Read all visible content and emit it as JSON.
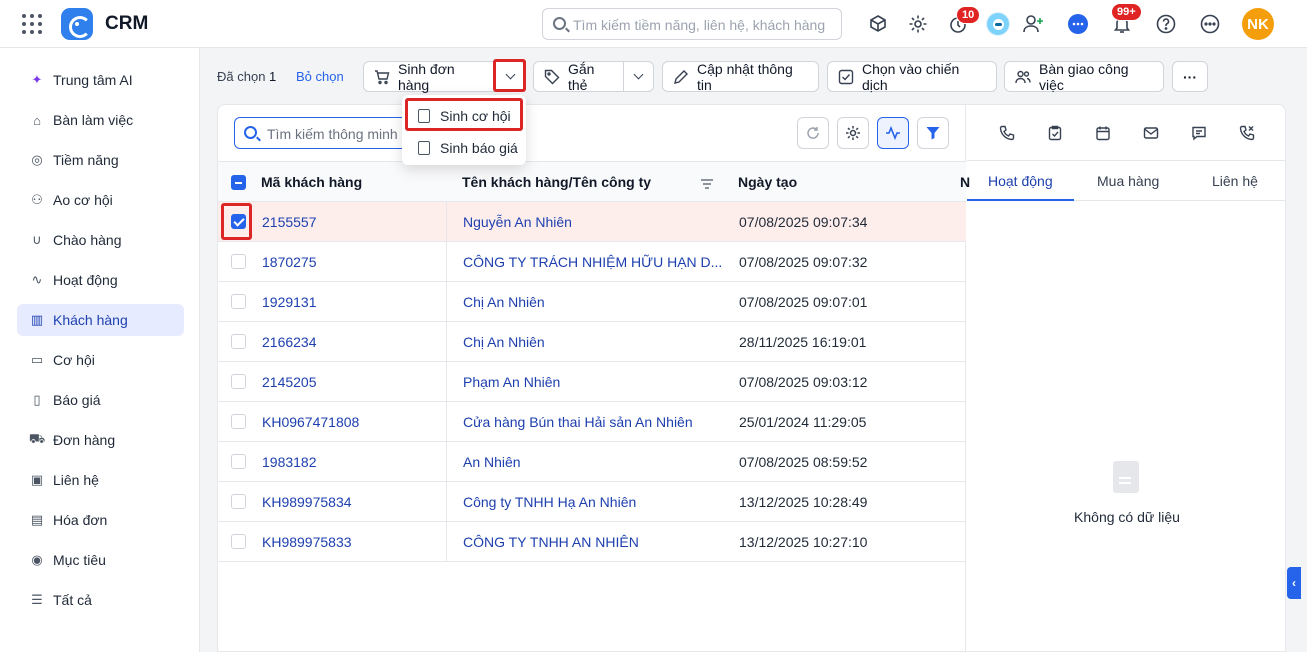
{
  "app": {
    "title": "CRM"
  },
  "topbar": {
    "search_placeholder": "Tìm kiếm tiềm năng, liên hệ, khách hàng",
    "timer_badge": "10",
    "notification_badge": "99+",
    "avatar_initials": "NK",
    "avatar_color": "#f59e0b"
  },
  "sidebar": {
    "items": [
      {
        "label": "Trung tâm AI",
        "icon": "sparkle-icon"
      },
      {
        "label": "Bàn làm việc",
        "icon": "home-icon"
      },
      {
        "label": "Tiềm năng",
        "icon": "target-icon"
      },
      {
        "label": "Ao cơ hội",
        "icon": "pool-icon"
      },
      {
        "label": "Chào hàng",
        "icon": "magnet-icon"
      },
      {
        "label": "Hoạt động",
        "icon": "pulse-icon"
      },
      {
        "label": "Khách hàng",
        "icon": "building-icon",
        "active": true
      },
      {
        "label": "Cơ hội",
        "icon": "wallet-icon"
      },
      {
        "label": "Báo giá",
        "icon": "quote-icon"
      },
      {
        "label": "Đơn hàng",
        "icon": "cart-icon"
      },
      {
        "label": "Liên hệ",
        "icon": "contact-icon"
      },
      {
        "label": "Hóa đơn",
        "icon": "invoice-icon"
      },
      {
        "label": "Mục tiêu",
        "icon": "goal-icon"
      },
      {
        "label": "Tất cả",
        "icon": "list-icon"
      }
    ]
  },
  "actionbar": {
    "selected_label": "Đã chọn",
    "selected_count": "1",
    "deselect": "Bỏ chọn",
    "create_order": "Sinh đơn hàng",
    "tag": "Gắn thẻ",
    "update_info": "Cập nhật thông tin",
    "add_campaign": "Chọn vào chiến dịch",
    "handover": "Bàn giao công việc",
    "more": "···"
  },
  "dropdown": {
    "items": [
      "Sinh cơ hội",
      "Sinh báo giá"
    ]
  },
  "list": {
    "search_placeholder": "Tìm kiếm thông minh",
    "columns": [
      "Mã khách hàng",
      "Tên khách hàng/Tên công ty",
      "Ngày tạo",
      "N"
    ],
    "rows": [
      {
        "code": "2155557",
        "name": "Nguyễn An Nhiên",
        "created": "07/08/2025 09:07:34",
        "checked": true
      },
      {
        "code": "1870275",
        "name": "CÔNG TY TRÁCH NHIỆM HỮU HẠN D...",
        "created": "07/08/2025 09:07:32"
      },
      {
        "code": "1929131",
        "name": "Chị An Nhiên",
        "created": "07/08/2025 09:07:01"
      },
      {
        "code": "2166234",
        "name": "Chị An Nhiên",
        "created": "28/11/2025 16:19:01"
      },
      {
        "code": "2145205",
        "name": "Phạm An Nhiên",
        "created": "07/08/2025 09:03:12"
      },
      {
        "code": "KH0967471808",
        "name": "Cửa hàng Bún thai Hải sản An Nhiên",
        "created": "25/01/2024 11:29:05"
      },
      {
        "code": "1983182",
        "name": "An Nhiên",
        "created": "07/08/2025 08:59:52"
      },
      {
        "code": "KH989975834",
        "name": "Công ty TNHH Hạ An Nhiên",
        "created": "13/12/2025 10:28:49"
      },
      {
        "code": "KH989975833",
        "name": "CÔNG TY TNHH AN NHIÊN",
        "created": "13/12/2025 10:27:10"
      }
    ]
  },
  "right_panel": {
    "tabs": [
      "Hoạt động",
      "Mua hàng",
      "Liên hệ"
    ],
    "active_tab": "Hoạt động",
    "empty_text": "Không có dữ liệu"
  },
  "colors": {
    "accent": "#2563eb",
    "highlight_border": "#dc2626",
    "selected_row": "#fdeeec"
  }
}
